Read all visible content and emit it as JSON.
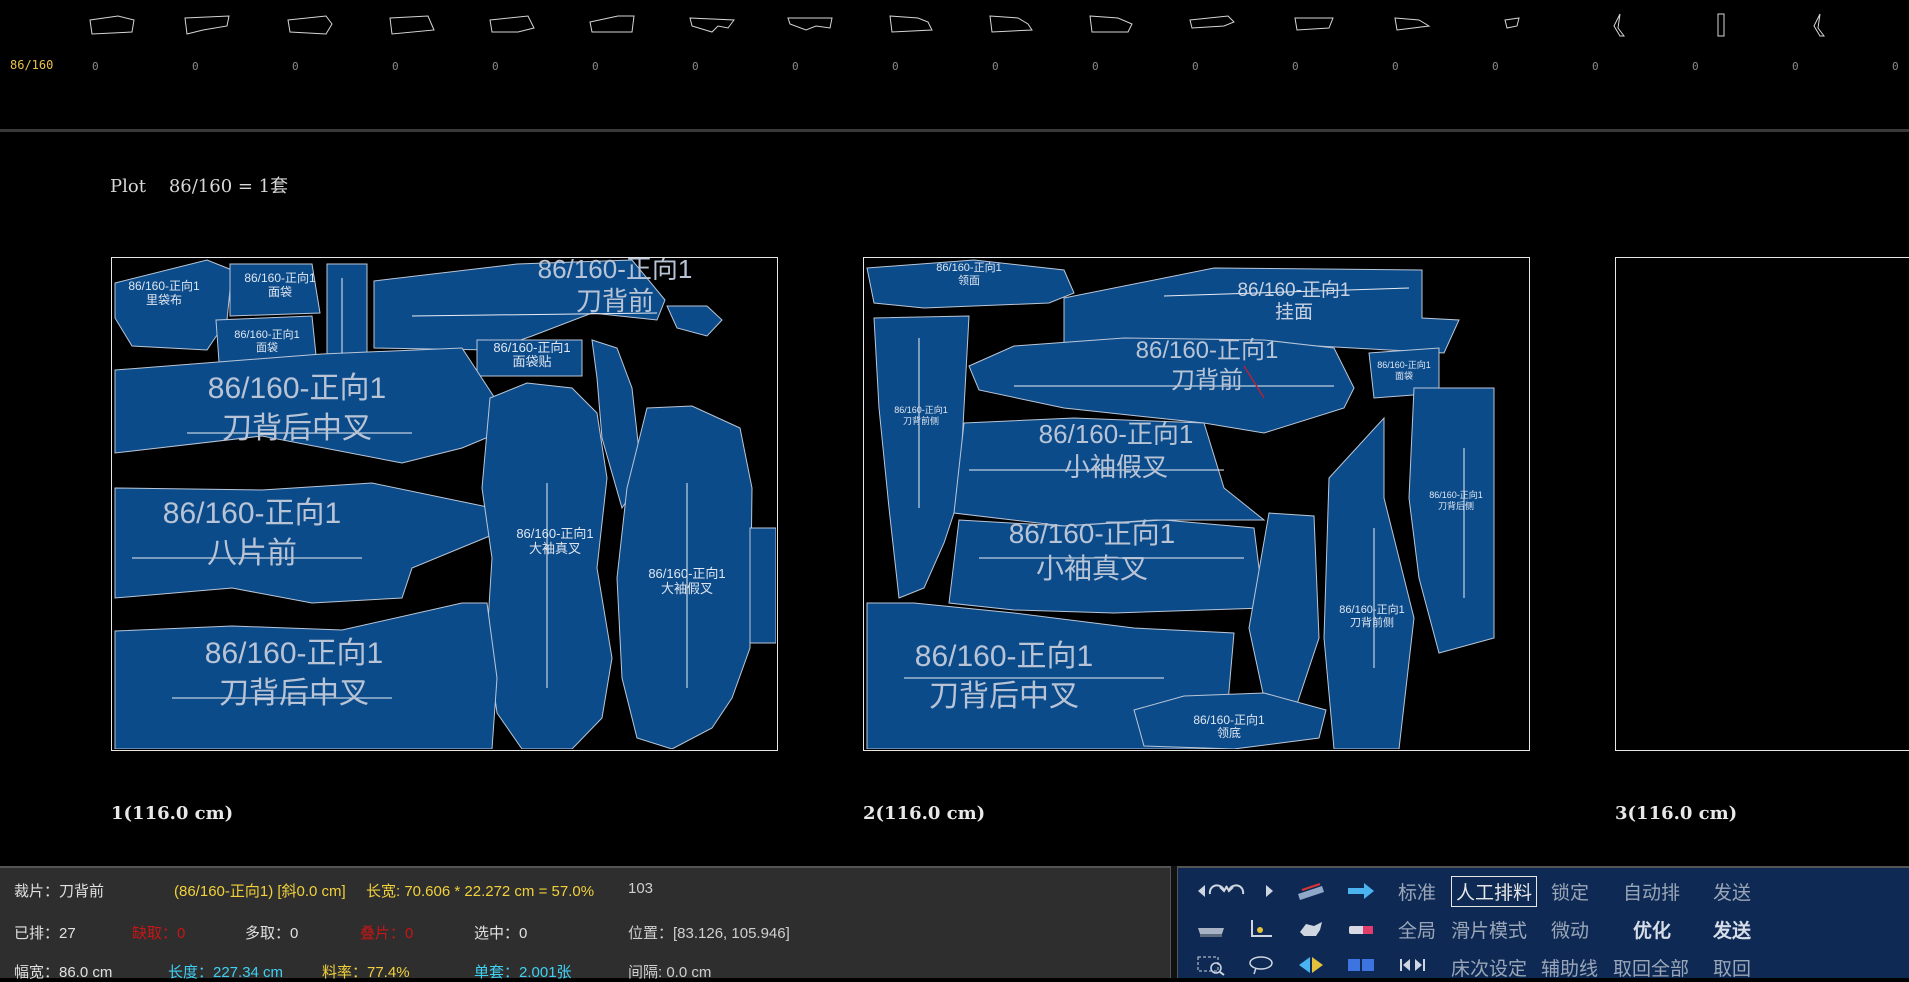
{
  "top_strip": {
    "size_label": "86/160",
    "counts": [
      "0",
      "0",
      "0",
      "0",
      "0",
      "0",
      "0",
      "0",
      "0",
      "0",
      "0",
      "0",
      "0",
      "0",
      "0",
      "0",
      "0",
      "0",
      "0"
    ]
  },
  "plot_title": "Plot    86/160 = 1套",
  "sheets": [
    {
      "label": "1(116.0 cm)"
    },
    {
      "label": "2(116.0 cm)"
    },
    {
      "label": "3(116.0 cm)"
    }
  ],
  "pieces": {
    "s1": [
      {
        "l1": "86/160-正向1",
        "l2": "里袋布"
      },
      {
        "l1": "86/160-正向1",
        "l2": "面袋"
      },
      {
        "l1": "86/160-正向1",
        "l2": "面袋"
      },
      {
        "l1": "86/160-正向1",
        "l2": "刀背前"
      },
      {
        "l1": "86/160-正向1",
        "l2": "面袋贴"
      },
      {
        "l1": "86/160-正向1",
        "l2": "刀背后中叉"
      },
      {
        "l1": "86/160-正向1",
        "l2": "八片前"
      },
      {
        "l1": "86/160-正向1",
        "l2": "大袖真叉"
      },
      {
        "l1": "86/160-正向1",
        "l2": "大袖假叉"
      },
      {
        "l1": "86/160-正向1",
        "l2": "刀背后中叉"
      }
    ],
    "s2": [
      {
        "l1": "86/160-正向1",
        "l2": "领面"
      },
      {
        "l1": "86/160-正向1",
        "l2": "挂面"
      },
      {
        "l1": "86/160-正向1",
        "l2": "刀背前"
      },
      {
        "l1": "86/160-正向1",
        "l2": "面袋"
      },
      {
        "l1": "86/160-正向1",
        "l2": "刀背前侧"
      },
      {
        "l1": "86/160-正向1",
        "l2": "小袖假叉"
      },
      {
        "l1": "86/160-正向1",
        "l2": "小袖真叉"
      },
      {
        "l1": "86/160-正向1",
        "l2": "刀背后侧"
      },
      {
        "l1": "86/160-正向1",
        "l2": "刀背前侧"
      },
      {
        "l1": "86/160-正向1",
        "l2": "刀背后中叉"
      },
      {
        "l1": "86/160-正向1",
        "l2": "领底"
      }
    ]
  },
  "info": {
    "cut_piece": "裁片：刀背前",
    "piece_detail": "(86/160-正向1) [斜0.0 cm]",
    "size_calc": "长宽: 70.606 * 22.272 cm = 57.0%",
    "id_num": "103",
    "placed": "已排：27",
    "missing": "缺取：0",
    "extra": "多取：0",
    "overlap": "叠片：0",
    "selected": "选中：0",
    "position": "位置：[83.126, 105.946]",
    "width": "幅宽：86.0 cm",
    "length": "长度：227.34 cm",
    "rate": "料率：77.4%",
    "sets": "单套：2.001张",
    "gap": "间隔: 0.0 cm"
  },
  "toolbar": {
    "row1": [
      "标准",
      "人工排料",
      "锁定",
      "自动排",
      "发送"
    ],
    "row2": [
      "全局",
      "滑片模式",
      "微动",
      "优化",
      "发送"
    ],
    "row3": [
      "床次设定",
      "辅助线",
      "取回全部",
      "取回"
    ]
  },
  "colors": {
    "piece_fill": "#0c4b8a",
    "piece_stroke": "#b9c6d8",
    "bg": "#000000",
    "accent_yellow": "#f1d13b",
    "accent_red": "#c91515",
    "accent_cyan": "#3fd0f3",
    "tool_bg": "#0e2a54"
  }
}
